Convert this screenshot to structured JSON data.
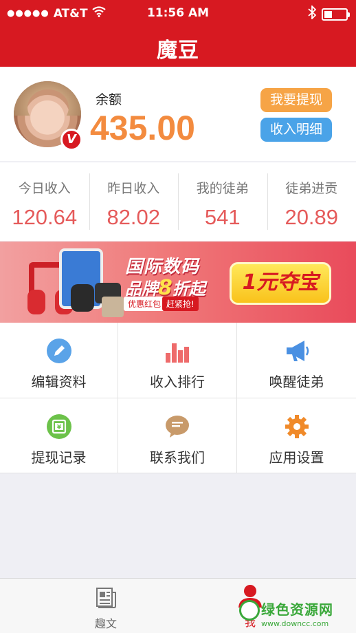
{
  "status_bar": {
    "signal_dots": "●●●●●",
    "carrier": "AT&T",
    "time": "11:56 AM",
    "battery_level": 0.35
  },
  "header": {
    "title": "魔豆"
  },
  "profile": {
    "balance_label": "余额",
    "balance_value": "435.00",
    "verified_badge": "V",
    "buttons": {
      "withdraw": "我要提现",
      "income_detail": "收入明细"
    }
  },
  "stats": [
    {
      "label": "今日收入",
      "value": "120.64"
    },
    {
      "label": "昨日收入",
      "value": "82.02"
    },
    {
      "label": "我的徒弟",
      "value": "541"
    },
    {
      "label": "徒弟进贡",
      "value": "20.89"
    }
  ],
  "banner": {
    "title": "国际数码",
    "subtitle_prefix": "品牌",
    "subtitle_big": "8",
    "subtitle_suffix": "折起",
    "tag1": "优惠红包",
    "tag2": "赶紧抢!",
    "cta": "1元夺宝"
  },
  "menu": [
    {
      "label": "编辑资料",
      "icon": "pencil-icon",
      "color": "#5aa3e8"
    },
    {
      "label": "收入排行",
      "icon": "bar-chart-icon",
      "color": "#ee6b6b"
    },
    {
      "label": "唤醒徒弟",
      "icon": "megaphone-icon",
      "color": "#4a90e2"
    },
    {
      "label": "提现记录",
      "icon": "atm-icon",
      "color": "#6cc24a"
    },
    {
      "label": "联系我们",
      "icon": "chat-bubble-icon",
      "color": "#c89a6a"
    },
    {
      "label": "应用设置",
      "icon": "gear-icon",
      "color": "#f08a2a"
    }
  ],
  "tabbar": {
    "read": "趣文",
    "me": "我"
  },
  "watermark": {
    "line1": "绿色资源网",
    "line2": "www.downcc.com"
  },
  "colors": {
    "brand_red": "#d71921",
    "balance_orange": "#f38b3f",
    "stat_red": "#e55a5a"
  }
}
